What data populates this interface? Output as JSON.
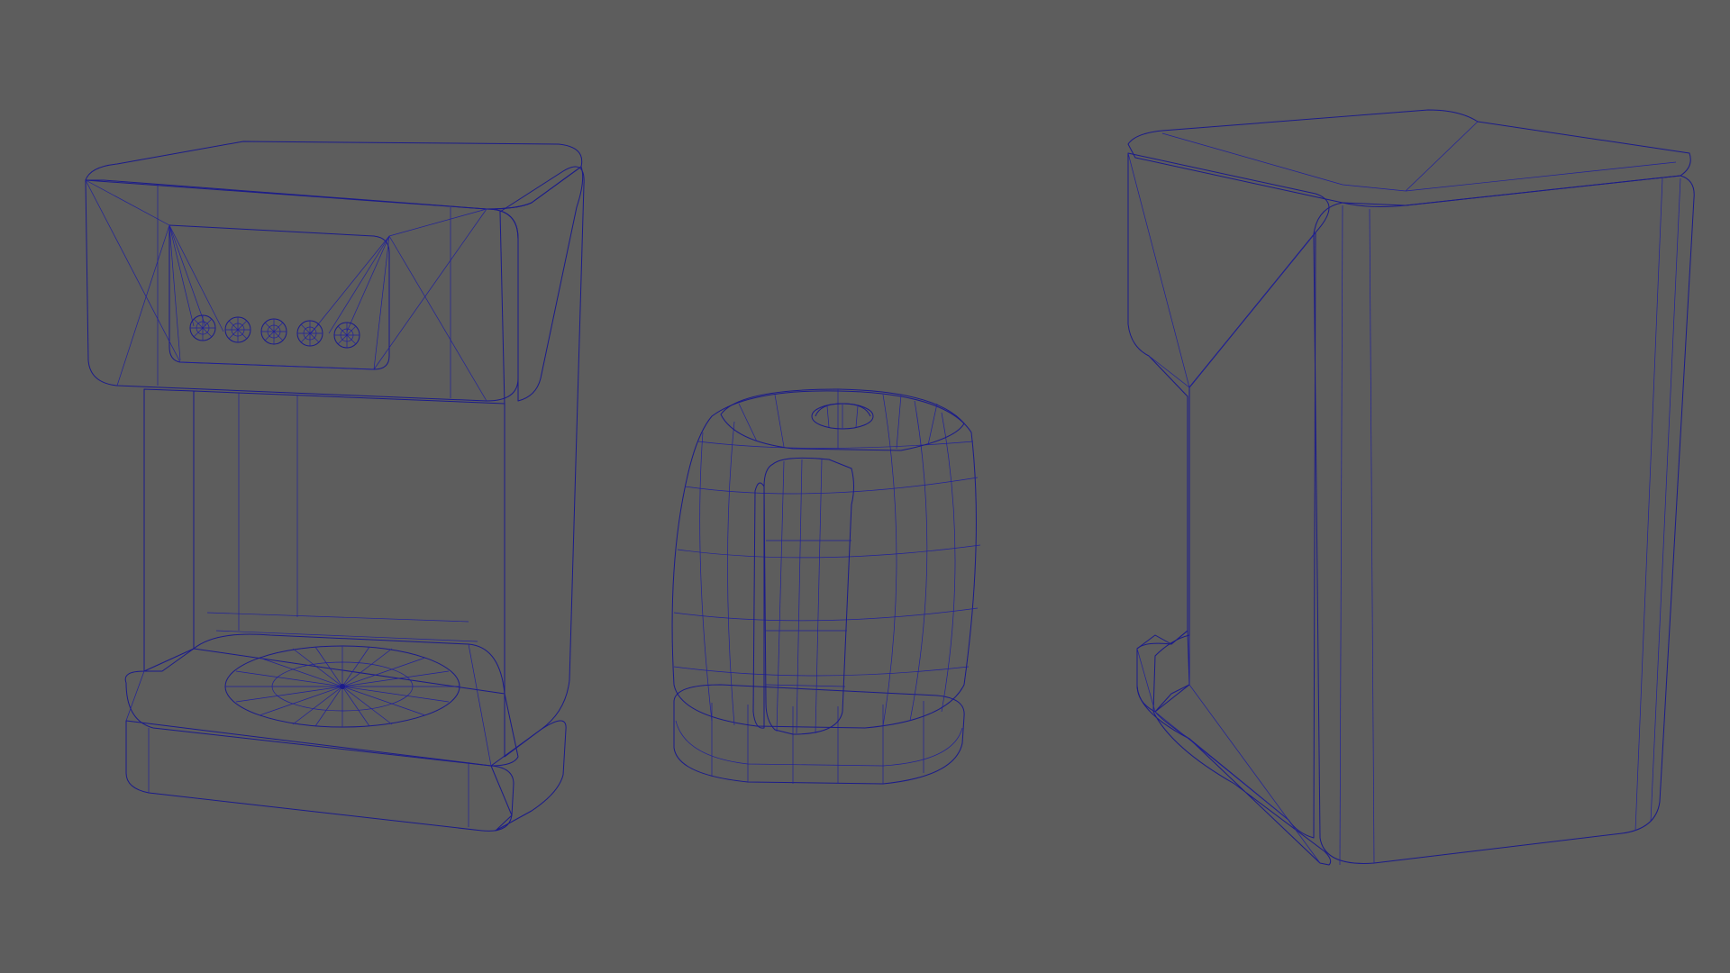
{
  "scene": {
    "background_color": "#5d5d5d",
    "mesh_color": "#808080",
    "wireframe_color": "#1c1c8a",
    "objects": [
      {
        "name": "coffee-maker",
        "button_count": 5
      },
      {
        "name": "coffee-carafe"
      },
      {
        "name": "coffee-maker-side-view"
      }
    ]
  }
}
